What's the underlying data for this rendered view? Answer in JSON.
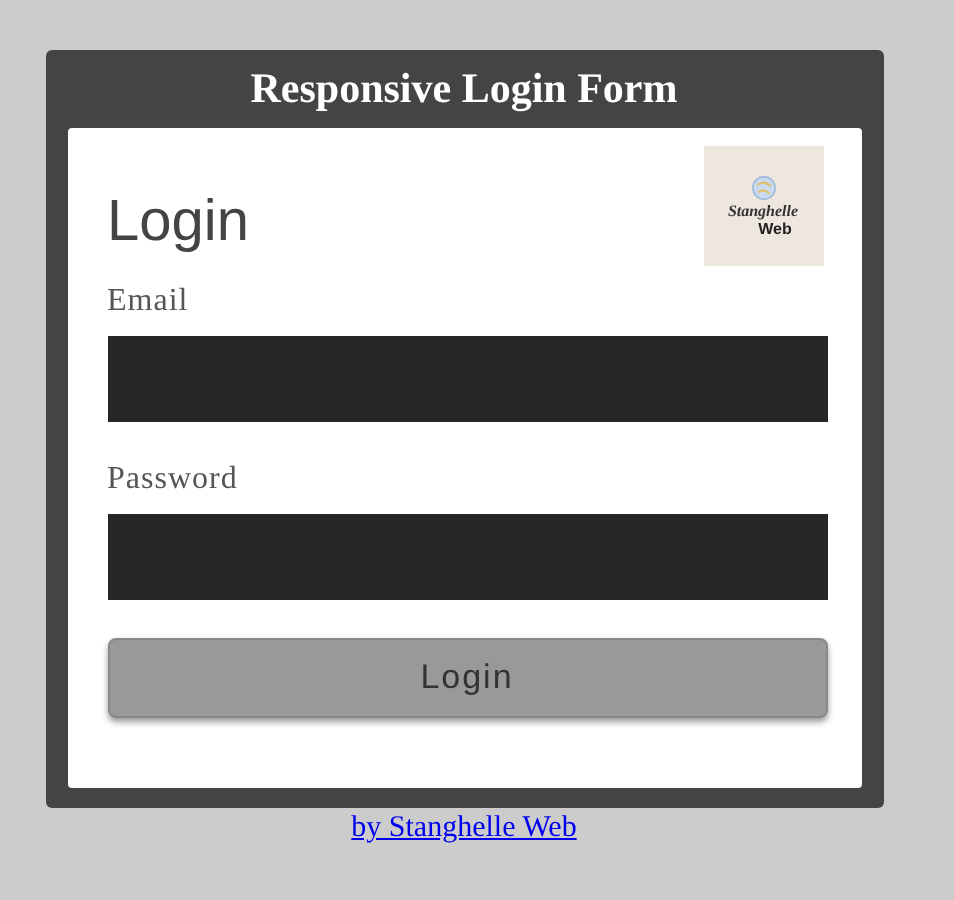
{
  "page_title": "Responsive Login Form",
  "form": {
    "heading": "Login",
    "logo": {
      "line_1": "Stanghelle",
      "line_2": "Web"
    },
    "fields": [
      {
        "label": "Email"
      },
      {
        "label": "Password"
      }
    ],
    "submit_button": "Login"
  },
  "footer_link": "by Stanghelle Web"
}
